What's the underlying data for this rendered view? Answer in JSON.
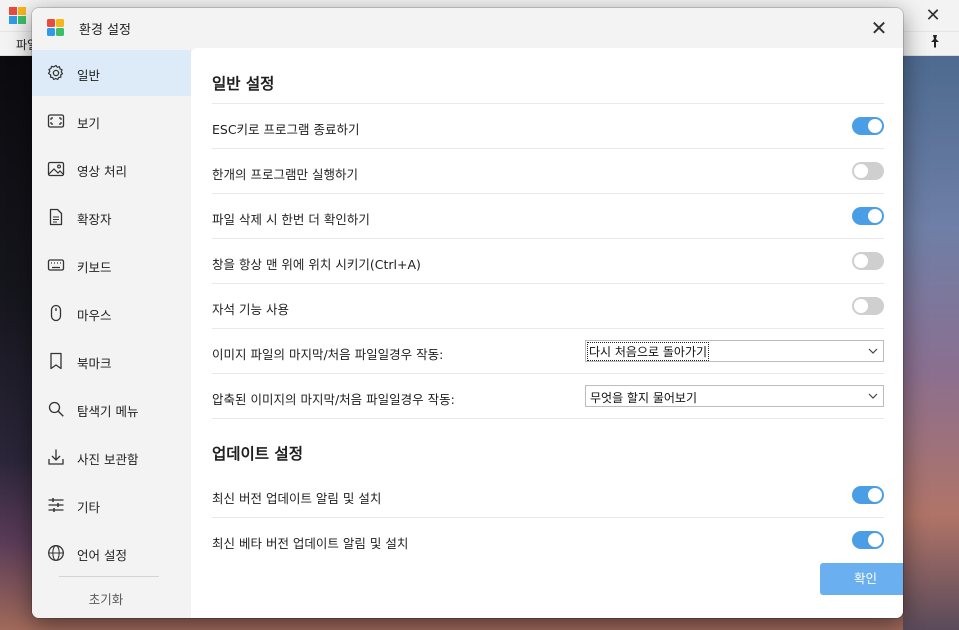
{
  "background_app": {
    "menu_first": "파일",
    "close_glyph": "✕",
    "pin_glyph": "📌"
  },
  "dialog": {
    "title": "환경 설정",
    "close_glyph": "✕"
  },
  "sidebar": {
    "items": [
      {
        "label": "일반",
        "icon": "gear-icon",
        "active": true
      },
      {
        "label": "보기",
        "icon": "screen-icon",
        "active": false
      },
      {
        "label": "영상 처리",
        "icon": "image-icon",
        "active": false
      },
      {
        "label": "확장자",
        "icon": "document-icon",
        "active": false
      },
      {
        "label": "키보드",
        "icon": "keyboard-icon",
        "active": false
      },
      {
        "label": "마우스",
        "icon": "mouse-icon",
        "active": false
      },
      {
        "label": "북마크",
        "icon": "bookmark-icon",
        "active": false
      },
      {
        "label": "탐색기 메뉴",
        "icon": "search-icon",
        "active": false
      },
      {
        "label": "사진 보관함",
        "icon": "download-icon",
        "active": false
      },
      {
        "label": "기타",
        "icon": "sliders-icon",
        "active": false
      },
      {
        "label": "언어 설정",
        "icon": "globe-icon",
        "active": false
      }
    ],
    "reset_label": "초기화"
  },
  "general": {
    "title": "일반 설정",
    "settings": [
      {
        "label": "ESC키로 프로그램 종료하기",
        "type": "toggle",
        "on": true
      },
      {
        "label": "한개의 프로그램만 실행하기",
        "type": "toggle",
        "on": false
      },
      {
        "label": "파일 삭제 시 한번 더 확인하기",
        "type": "toggle",
        "on": true
      },
      {
        "label": "창을 항상 맨 위에 위치 시키기(Ctrl+A)",
        "type": "toggle",
        "on": false
      },
      {
        "label": "자석 기능 사용",
        "type": "toggle",
        "on": false
      },
      {
        "label": "이미지 파일의 마지막/처음 파일일경우 작동:",
        "type": "select",
        "value": "다시 처음으로 돌아가기"
      },
      {
        "label": "압축된 이미지의 마지막/처음 파일일경우 작동:",
        "type": "select",
        "value": "무엇을 할지 물어보기"
      }
    ]
  },
  "update": {
    "title": "업데이트 설정",
    "settings": [
      {
        "label": "최신 버전 업데이트 알림 및 설치",
        "type": "toggle",
        "on": true
      },
      {
        "label": "최신 베타 버전 업데이트 알림 및 설치",
        "type": "toggle",
        "on": true
      }
    ]
  },
  "confirm_label": "확인",
  "colors": {
    "accent": "#4a9ee6",
    "confirm": "#6ab0f0",
    "sidebar_active": "#dcebf7"
  }
}
